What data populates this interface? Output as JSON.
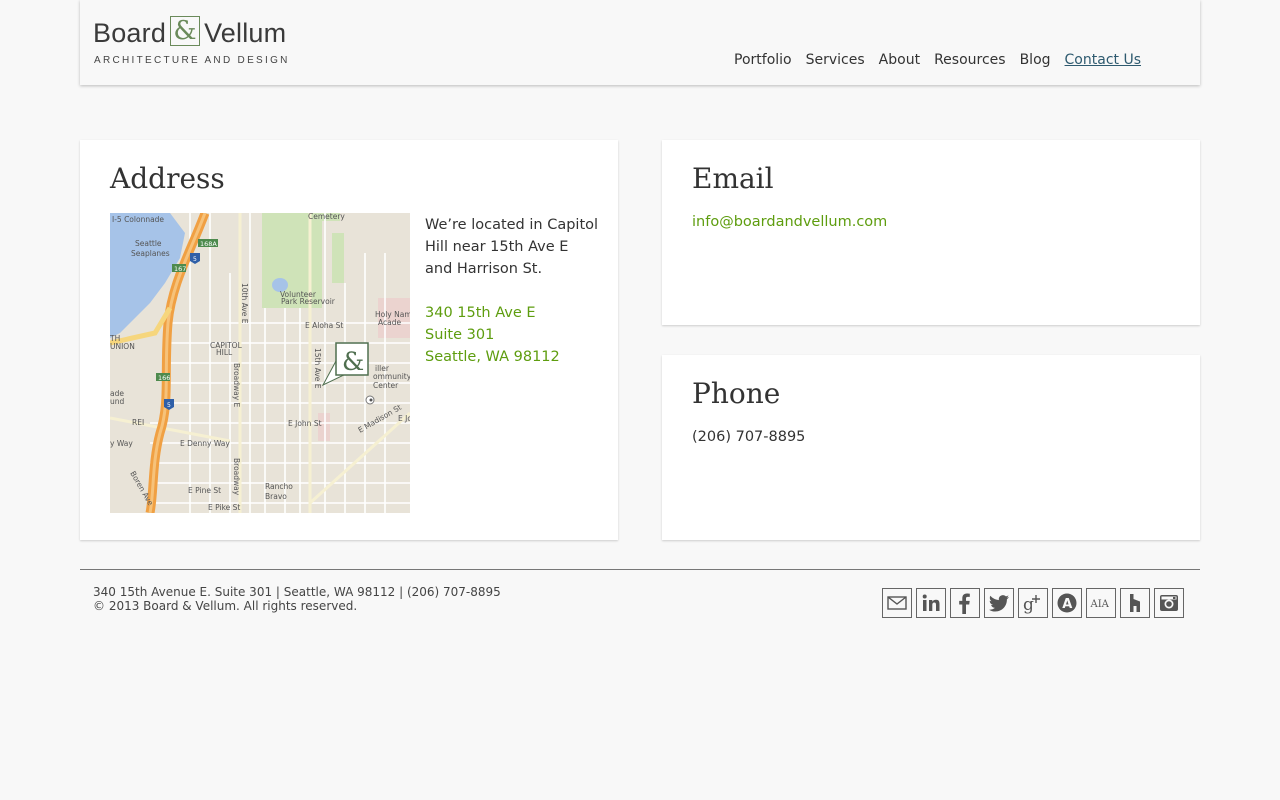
{
  "brand": {
    "name_left": "Board",
    "ampersand": "&",
    "name_right": "Vellum",
    "tagline": "ARCHITECTURE AND DESIGN"
  },
  "nav": {
    "items": [
      "Portfolio",
      "Services",
      "About",
      "Resources",
      "Blog",
      "Contact Us"
    ],
    "active": "Contact Us"
  },
  "address": {
    "heading": "Address",
    "description": "We’re located in Capitol Hill near 15th Ave E and Harrison St.",
    "lines": [
      "340 15th Ave E",
      "Suite 301",
      "Seattle, WA 98112"
    ],
    "map": {
      "labels": [
        "I-5 Colonnade",
        "Cemetery",
        "Seattle Seaplanes",
        "Volunteer Park Reservoir",
        "10th Ave E",
        "E Aloha St",
        "Holy Names Academy",
        "CAPITOL HILL",
        "Broadway E",
        "15th Ave E",
        "Miller Community Center",
        "E John St",
        "REI",
        "E Denny Way",
        "E Pine St",
        "E Pike St",
        "Rancho Bravo",
        "E Madison St",
        "Boren Ave",
        "TH UNION",
        "ade und",
        "168A",
        "167",
        "5",
        "166"
      ]
    }
  },
  "email": {
    "heading": "Email",
    "address": "info@boardandvellum.com"
  },
  "phone": {
    "heading": "Phone",
    "number": "(206) 707-8895"
  },
  "footer": {
    "line1": "340 15th Avenue E. Suite 301 | Seattle, WA 98112 | (206) 707-8895",
    "line2": "© 2013 Board & Vellum. All rights reserved.",
    "social": [
      "email-icon",
      "linkedin-icon",
      "facebook-icon",
      "twitter-icon",
      "google-plus-icon",
      "archdaily-icon",
      "aia-icon",
      "houzz-icon",
      "instagram-icon"
    ],
    "aia_label": "AIA"
  },
  "colors": {
    "accent_green": "#5e9d0f",
    "active_nav": "#2e5a6f",
    "background": "#f8f8f8"
  }
}
